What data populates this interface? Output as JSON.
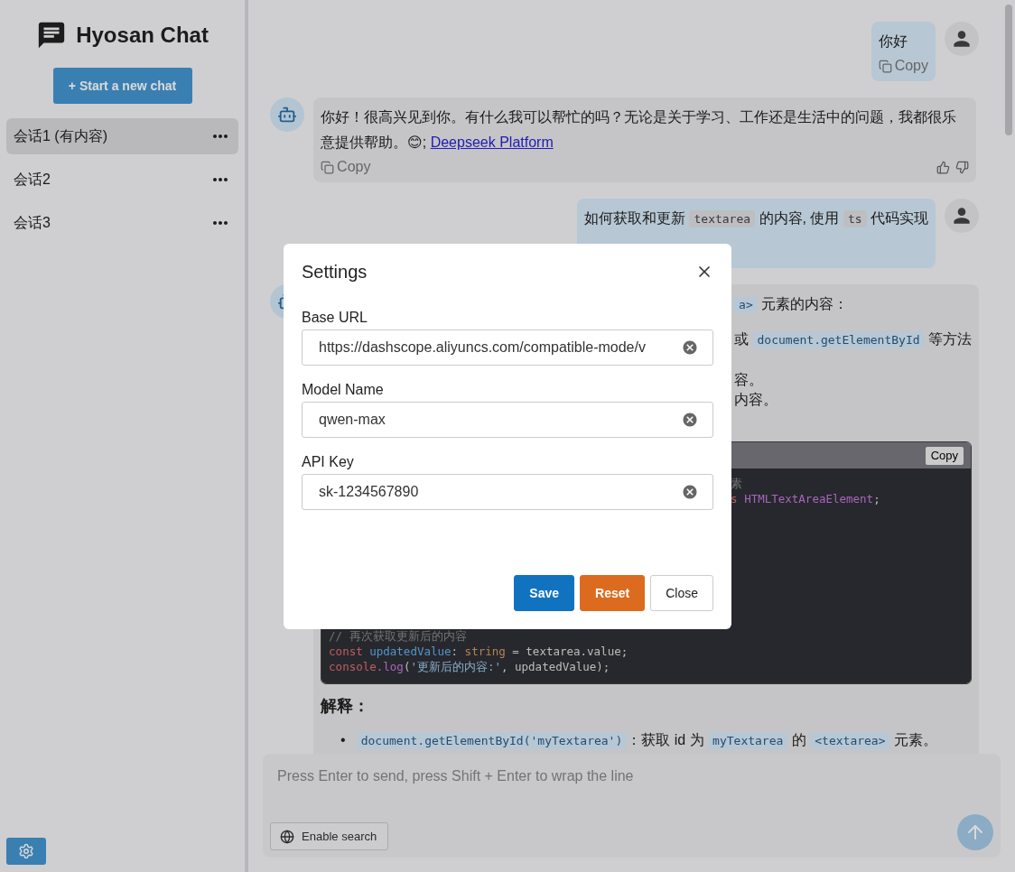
{
  "app": {
    "title": "Hyosan Chat"
  },
  "new_chat_button": "+ Start a new chat",
  "conversations": [
    {
      "title": "会话1 (有内容)",
      "selected": true
    },
    {
      "title": "会话2",
      "selected": false
    },
    {
      "title": "会话3",
      "selected": false
    }
  ],
  "messages": [
    {
      "kind": "user",
      "segments": [
        {
          "kind": "text",
          "text": "你好"
        }
      ],
      "copy": "Copy"
    },
    {
      "kind": "bot",
      "segments": [
        {
          "kind": "text",
          "text": "你好！很高兴见到你。有什么我可以帮忙的吗？无论是关于学习、工作还是生活中的问题，我都很乐意提供帮助。😊; "
        },
        {
          "kind": "link",
          "text": "Deepseek Platform"
        }
      ],
      "copy": "Copy",
      "feedback": true
    },
    {
      "kind": "user",
      "segments": [
        {
          "kind": "text",
          "text": "如何获取和更新 "
        },
        {
          "kind": "code",
          "text": "textarea"
        },
        {
          "kind": "text",
          "text": " 的内容, 使用 "
        },
        {
          "kind": "code",
          "text": "ts"
        },
        {
          "kind": "text",
          "text": " 代码实现"
        }
      ]
    },
    {
      "kind": "bot-partial",
      "partial_lines": [
        [
          {
            "kind": "code",
            "text": "a>"
          },
          {
            "kind": "text",
            "text": " 元素的内容："
          }
        ],
        [
          {
            "kind": "text",
            "text": "或 "
          },
          {
            "kind": "code",
            "text": "document.getElementById"
          },
          {
            "kind": "text",
            "text": " 等方法"
          }
        ],
        [
          {
            "kind": "text",
            "text": "容。"
          }
        ],
        [
          {
            "kind": "text",
            "text": "内容。"
          }
        ]
      ],
      "code_block": {
        "copy": "Copy",
        "partial_lines": [
          [
            {
              "kind": "comment",
              "text": "素"
            }
          ],
          [
            {
              "kind": "keyword",
              "text": "s "
            },
            {
              "kind": "type",
              "text": "HTMLTextAreaElement"
            },
            {
              "kind": "plain",
              "text": ";"
            }
          ]
        ],
        "lines": [
          [
            {
              "kind": "comment",
              "text": "// 再次获取更新后的内容"
            }
          ],
          [
            {
              "kind": "keyword",
              "text": "const "
            },
            {
              "kind": "variable",
              "text": "updatedValue"
            },
            {
              "kind": "plain",
              "text": ": "
            },
            {
              "kind": "type-builtin",
              "text": "string"
            },
            {
              "kind": "plain",
              "text": " = textarea.value;"
            }
          ],
          [
            {
              "kind": "keyword",
              "text": "console"
            },
            {
              "kind": "function",
              "text": ".log"
            },
            {
              "kind": "plain",
              "text": "("
            },
            {
              "kind": "string",
              "text": "'更新后的内容:'"
            },
            {
              "kind": "plain",
              "text": ", updatedValue);"
            }
          ]
        ]
      },
      "heading": "解释：",
      "bullets": [
        {
          "marker": "•",
          "segments": [
            {
              "kind": "code",
              "text": "document.getElementById('myTextarea')"
            },
            {
              "kind": "text",
              "text": "：获取 id 为 "
            },
            {
              "kind": "code",
              "text": "myTextarea"
            },
            {
              "kind": "text",
              "text": " 的 "
            },
            {
              "kind": "code",
              "text": "<textarea>"
            },
            {
              "kind": "text",
              "text": " 元素。"
            }
          ]
        }
      ]
    }
  ],
  "composer": {
    "placeholder": "Press Enter to send, press Shift + Enter to wrap the line",
    "search_button": "Enable search"
  },
  "settings_dialog": {
    "title": "Settings",
    "fields": [
      {
        "label": "Base URL",
        "value": "https://dashscope.aliyuncs.com/compatible-mode/v"
      },
      {
        "label": "Model Name",
        "value": "qwen-max"
      },
      {
        "label": "API Key",
        "value": "sk-1234567890"
      }
    ],
    "buttons": [
      {
        "kind": "primary",
        "label": "Save"
      },
      {
        "kind": "warning",
        "label": "Reset"
      },
      {
        "kind": "default",
        "label": "Close"
      }
    ]
  }
}
